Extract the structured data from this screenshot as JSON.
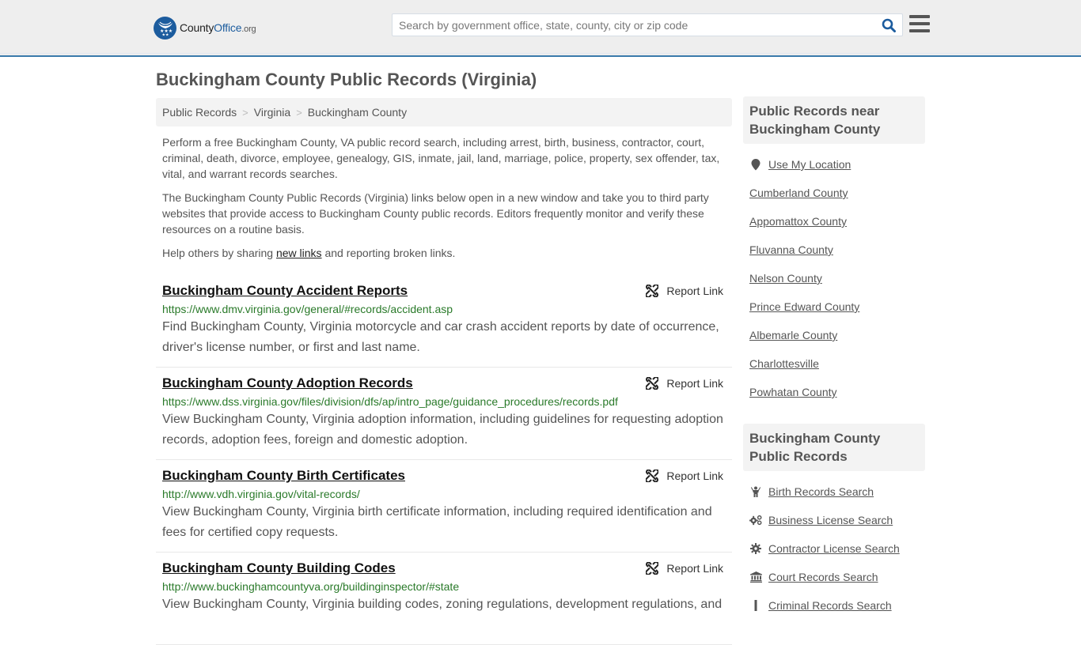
{
  "header": {
    "logo": {
      "name_main": "County",
      "name_accent": "Office",
      "tld": ".org"
    },
    "search": {
      "placeholder": "Search by government office, state, county, city or zip code",
      "value": ""
    },
    "colors": {
      "brand": "#1c5c9e",
      "header_bg": "#eeeeee",
      "header_border": "#3a7aab"
    }
  },
  "page": {
    "title": "Buckingham County Public Records (Virginia)",
    "breadcrumb": [
      "Public Records",
      "Virginia",
      "Buckingham County"
    ],
    "intro": [
      "Perform a free Buckingham County, VA public record search, including arrest, birth, business, contractor, court, criminal, death, divorce, employee, genealogy, GIS, inmate, jail, land, marriage, police, property, sex offender, tax, vital, and warrant records searches.",
      "The Buckingham County Public Records (Virginia) links below open in a new window and take you to third party websites that provide access to Buckingham County public records. Editors frequently monitor and verify these resources on a routine basis."
    ],
    "help": {
      "before": "Help others by sharing ",
      "link": "new links",
      "after": " and reporting broken links."
    }
  },
  "records": [
    {
      "title": "Buckingham County Accident Reports",
      "url": "https://www.dmv.virginia.gov/general/#records/accident.asp",
      "description": "Find Buckingham County, Virginia motorcycle and car crash accident reports by date of occurrence, driver's license number, or first and last name.",
      "report_label": "Report Link"
    },
    {
      "title": "Buckingham County Adoption Records",
      "url": "https://www.dss.virginia.gov/files/division/dfs/ap/intro_page/guidance_procedures/records.pdf",
      "description": "View Buckingham County, Virginia adoption information, including guidelines for requesting adoption records, adoption fees, foreign and domestic adoption.",
      "report_label": "Report Link"
    },
    {
      "title": "Buckingham County Birth Certificates",
      "url": "http://www.vdh.virginia.gov/vital-records/",
      "description": "View Buckingham County, Virginia birth certificate information, including required identification and fees for certified copy requests.",
      "report_label": "Report Link"
    },
    {
      "title": "Buckingham County Building Codes",
      "url": "http://www.buckinghamcountyva.org/buildinginspector/#state",
      "description": "View Buckingham County, Virginia building codes, zoning regulations, development regulations, and",
      "report_label": "Report Link"
    }
  ],
  "sidebar": {
    "nearby": {
      "heading": "Public Records near Buckingham County",
      "use_location": {
        "label": "Use My Location",
        "icon": "map-marker-icon"
      },
      "items": [
        "Cumberland County",
        "Appomattox County",
        "Fluvanna County",
        "Nelson County",
        "Prince Edward County",
        "Albemarle County",
        "Charlottesville",
        "Powhatan County"
      ]
    },
    "records": {
      "heading": "Buckingham County Public Records",
      "items": [
        {
          "label": "Birth Records Search",
          "icon": "child-icon"
        },
        {
          "label": "Business License Search",
          "icon": "cogs-icon"
        },
        {
          "label": "Contractor License Search",
          "icon": "gear-icon"
        },
        {
          "label": "Court Records Search",
          "icon": "courthouse-icon"
        },
        {
          "label": "Criminal Records Search",
          "icon": "baton-icon"
        }
      ]
    }
  }
}
